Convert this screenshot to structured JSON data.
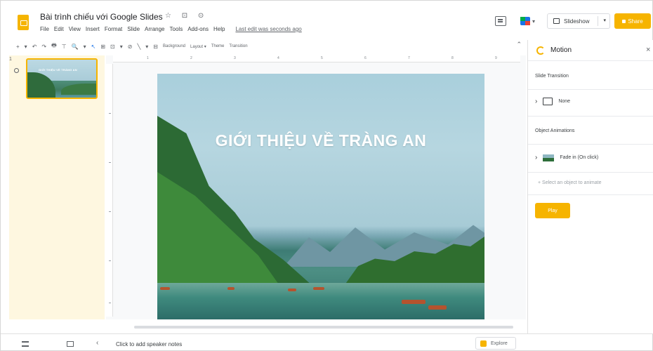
{
  "window": {
    "doc_title": "Bài trình chiếu với Google Slides",
    "title_icons": "☆ ⊡ ⊙"
  },
  "menu": {
    "items": [
      "File",
      "Edit",
      "View",
      "Insert",
      "Format",
      "Slide",
      "Arrange",
      "Tools",
      "Add-ons",
      "Help"
    ],
    "last_edit": "Last edit was seconds ago"
  },
  "header_actions": {
    "slideshow_label": "Slideshow",
    "share_label": "Share",
    "dropdown_glyph": "▾"
  },
  "toolbar": {
    "glyphs": [
      "+",
      "▾",
      "↶",
      "↷",
      "🖶",
      "⊤",
      "🔍",
      "▾",
      "↖",
      "⊞",
      "⊡",
      "▾",
      "⊘",
      "╲",
      "▾",
      "⊟"
    ],
    "text_buttons": [
      "Background",
      "Layout ▾",
      "Theme",
      "Transition"
    ],
    "collapse_glyph": "⌃"
  },
  "filmstrip": {
    "slide_number": "1",
    "thumb_title": "GIỚI THIỆU VỀ TRÀNG AN"
  },
  "slide": {
    "title": "GIỚI THIỆU VỀ TRÀNG AN"
  },
  "ruler": {
    "ticks": [
      "1",
      "2",
      "3",
      "4",
      "5",
      "6",
      "7",
      "8",
      "9"
    ]
  },
  "motion_panel": {
    "title": "Motion",
    "close_glyph": "×",
    "slide_transition_heading": "Slide Transition",
    "transition_value": "None",
    "object_animations_heading": "Object Animations",
    "animation_value": "Fade in  (On click)",
    "select_object_hint": "+ Select an object to animate",
    "play_label": "Play",
    "chevron_glyph": "›",
    "more_glyph": "⋮"
  },
  "bottom": {
    "speaker_notes": "Click to add speaker notes",
    "explore_label": "Explore",
    "collapse_glyph": "‹"
  },
  "colors": {
    "accent": "#f6b400",
    "filmstrip_bg": "#fef7e0"
  },
  "icons": [
    "slides-logo-icon",
    "star-icon",
    "folder-icon",
    "cloud-icon",
    "comment-icon",
    "meet-icon",
    "present-icon",
    "lock-icon",
    "motion-icon",
    "close-icon",
    "explore-icon",
    "grid-view-icon",
    "filmstrip-view-icon"
  ]
}
